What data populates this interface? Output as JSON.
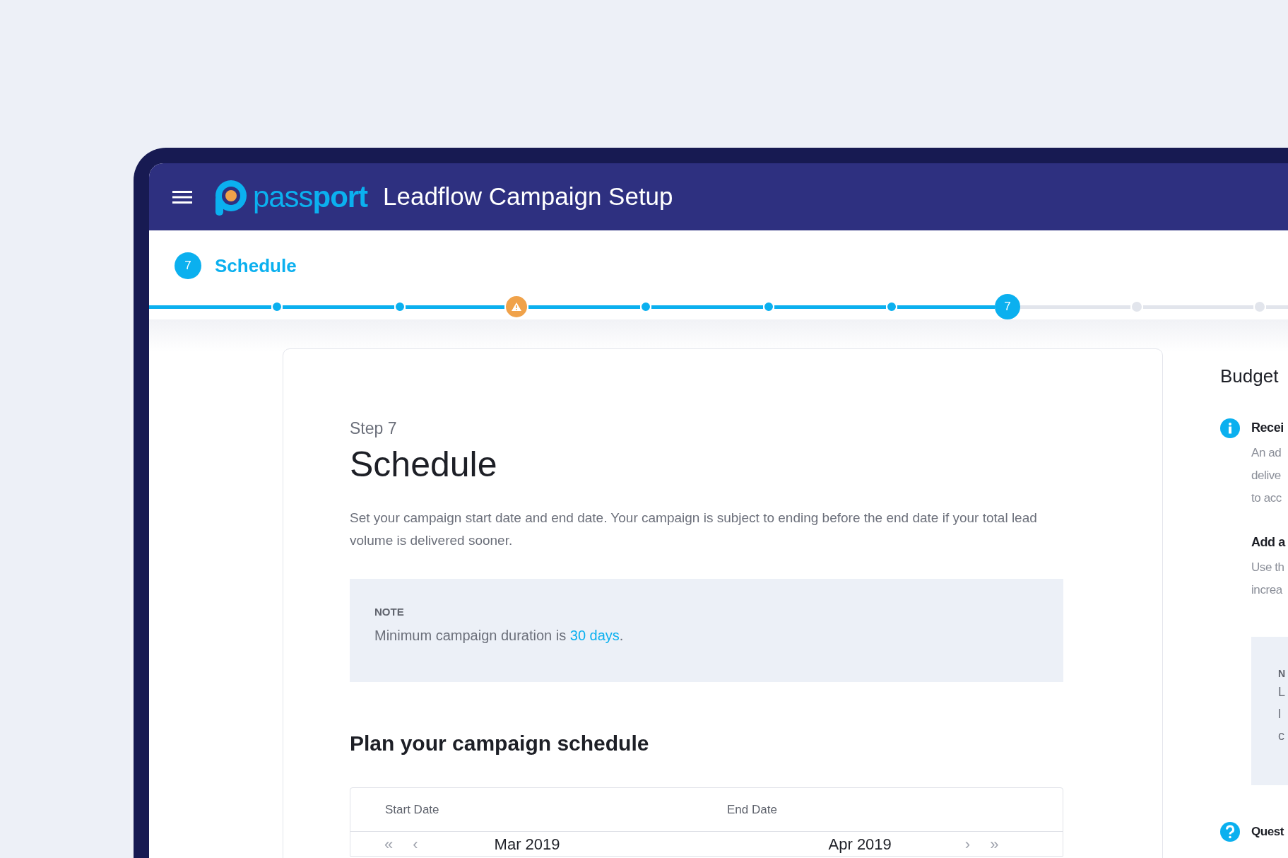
{
  "header": {
    "logo": "pass**port**",
    "title": "Leadflow Campaign Setup"
  },
  "current_step": {
    "number": "7",
    "label": "Schedule"
  },
  "stepper": [
    {
      "kind": "done"
    },
    {
      "kind": "done"
    },
    {
      "kind": "warning"
    },
    {
      "kind": "done"
    },
    {
      "kind": "done"
    },
    {
      "kind": "done"
    },
    {
      "kind": "current",
      "label": "7"
    },
    {
      "kind": "todo"
    },
    {
      "kind": "todo"
    }
  ],
  "card": {
    "eyebrow": "Step 7",
    "heading": "Schedule",
    "description": "Set your campaign start date and end date. Your campaign is subject to ending before the end date if your total lead volume is delivered sooner.",
    "note": {
      "label": "NOTE",
      "text": "Minimum campaign duration is ",
      "link": "30 days",
      "after": "."
    },
    "section_heading": "Plan your campaign schedule",
    "schedule_table": {
      "columns": [
        "Start Date",
        "End Date"
      ],
      "months": [
        "Mar 2019",
        "Apr 2019"
      ],
      "nav": [
        "«",
        "‹",
        "›",
        "»"
      ]
    }
  },
  "sidebar": {
    "title": "Budget",
    "items": [
      {
        "kind": "info",
        "title": "Recei",
        "lines": [
          "An ad",
          "delive",
          "to acc"
        ]
      },
      {
        "kind": "plain",
        "title": "Add a",
        "lines": [
          "Use th",
          "increa"
        ]
      }
    ],
    "note": {
      "label": "N",
      "lines": [
        "L",
        "l",
        "c"
      ]
    },
    "help": {
      "kind": "question",
      "title": "Quest"
    }
  }
}
